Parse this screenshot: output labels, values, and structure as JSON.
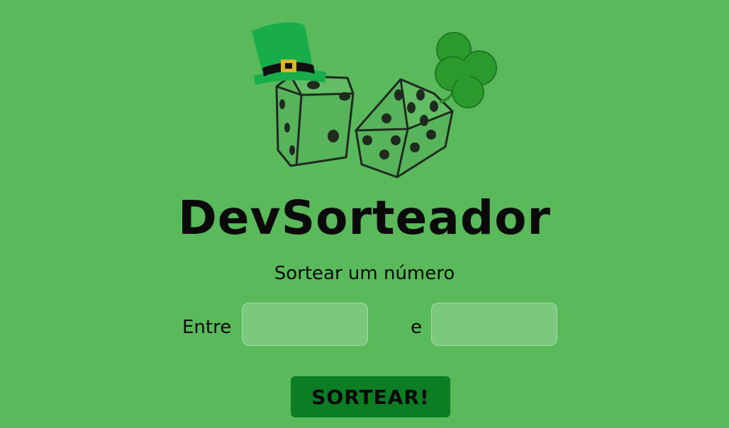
{
  "app": {
    "title": "DevSorteador",
    "subtitle": "Sortear um número"
  },
  "range": {
    "from_label": "Entre",
    "to_label": "e",
    "min_value": "",
    "max_value": ""
  },
  "actions": {
    "draw_label": "SORTEAR!"
  },
  "logo": {
    "icons": [
      "leprechaun-hat-icon",
      "dice-icon",
      "dice-icon",
      "four-leaf-clover-icon"
    ]
  },
  "colors": {
    "background": "#5ab95b",
    "button": "#0d7d24",
    "input": "#7bc97e",
    "text": "#0a0a0a"
  }
}
